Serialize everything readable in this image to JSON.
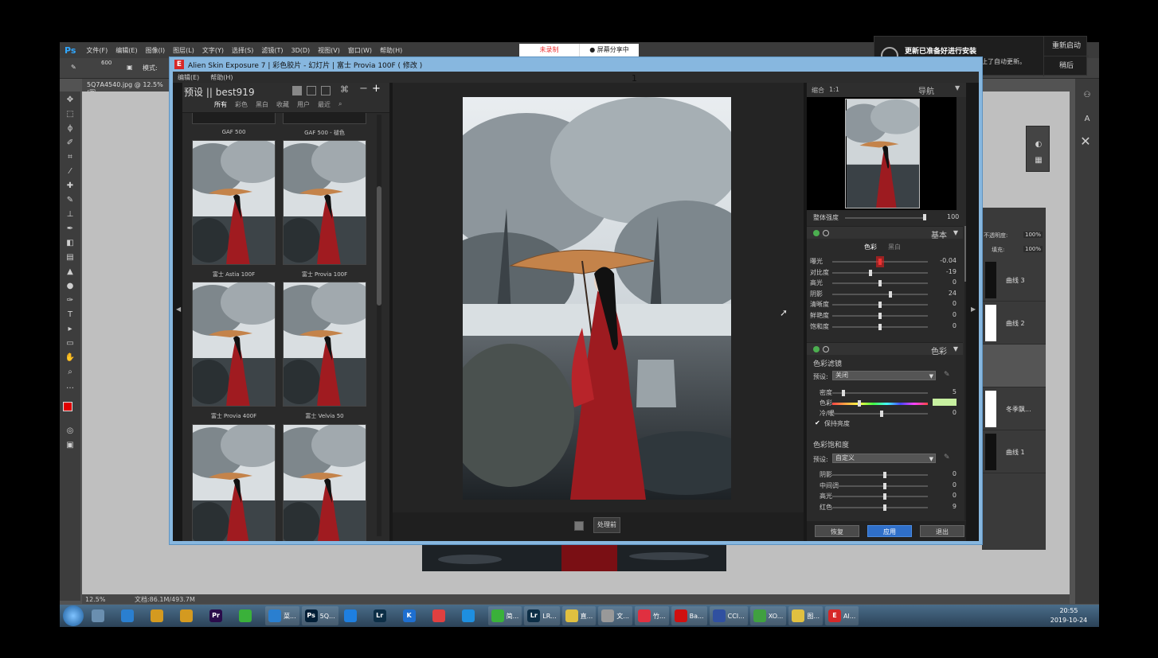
{
  "photoshop": {
    "logo": "Ps",
    "menu": [
      "文件(F)",
      "编辑(E)",
      "图像(I)",
      "图层(L)",
      "文字(Y)",
      "选择(S)",
      "滤镜(T)",
      "3D(D)",
      "视图(V)",
      "窗口(W)",
      "帮助(H)"
    ],
    "options": {
      "brush_size": "600",
      "mode_label": "模式:"
    },
    "doc_tab": "5Q7A4540.jpg @ 12.5% (图",
    "status_zoom": "12.5%",
    "status_doc": "文档:86.1M/493.7M",
    "layers": {
      "opacity_label": "不透明度:",
      "opacity_value": "100%",
      "fill_label": "填充:",
      "fill_value": "100%",
      "items": [
        "曲线 3",
        "曲线 2",
        "",
        "冬季飘...",
        "曲线 1"
      ]
    }
  },
  "notification": {
    "title": "更新已准备好进行安装",
    "body": "某些当前正在使用的应用阻止了自动更新。",
    "btn_restart": "重新启动",
    "btn_later": "稍后"
  },
  "recording": {
    "status": "未录制",
    "share": "● 屏幕分享中"
  },
  "exposure": {
    "logo": "E",
    "title": "Alien Skin Exposure 7 | 彩色胶片 - 幻灯片 | 富士 Provia 100F ( 修改 )",
    "menu": [
      "编辑(E)",
      "帮助(H)"
    ],
    "page_num": "1",
    "presets": {
      "title": "预设 || best919",
      "filters": [
        "所有",
        "彩色",
        "黑白",
        "收藏",
        "用户",
        "最近"
      ],
      "top_labels": [
        "GAF 500",
        "GAF 500 - 褪色"
      ],
      "items": [
        "富士 Astia 100F",
        "富士 Provia 100F",
        "富士 Provia 400F",
        "富士 Velvia 50",
        "",
        ""
      ]
    },
    "before_btn": "处理前",
    "nav": {
      "zoom": "缩合",
      "ratio": "1:1",
      "title": "导航"
    },
    "overall": {
      "label": "整体强度",
      "value": "100"
    },
    "basic": {
      "title": "基本",
      "tab_color": "色彩",
      "tab_bw": "黑白",
      "sliders": [
        {
          "label": "曝光",
          "value": "-0.04"
        },
        {
          "label": "对比度",
          "value": "-19"
        },
        {
          "label": "高光",
          "value": "0"
        },
        {
          "label": "阴影",
          "value": "24"
        },
        {
          "label": "清晰度",
          "value": "0"
        },
        {
          "label": "鲜艳度",
          "value": "0"
        },
        {
          "label": "饱和度",
          "value": "0"
        }
      ]
    },
    "color": {
      "title": "色彩",
      "filter_title": "色彩滤镜",
      "preset_label": "预设:",
      "preset_value": "关闭",
      "sliders": [
        {
          "label": "密度",
          "value": "5"
        },
        {
          "label": "色彩",
          "value": ""
        },
        {
          "label": "冷/暖",
          "value": "0"
        }
      ],
      "swatch_color": "#c7f0a0",
      "keep_luma": "保持亮度",
      "sat_title": "色彩饱和度",
      "sat_preset_label": "预设:",
      "sat_preset_value": "自定义",
      "sat_sliders": [
        {
          "label": "阴影",
          "value": "0"
        },
        {
          "label": "中间调",
          "value": "0"
        },
        {
          "label": "高光",
          "value": "0"
        },
        {
          "label": "红色",
          "value": "9"
        }
      ]
    },
    "buttons": {
      "reset": "恢复",
      "apply": "应用",
      "exit": "退出"
    }
  },
  "taskbar": {
    "items": [
      {
        "icon": "",
        "label": "",
        "color": "#6a8fb0"
      },
      {
        "icon": "",
        "label": "",
        "color": "#2a7fd0"
      },
      {
        "icon": "",
        "label": "",
        "color": "#d49a20"
      },
      {
        "icon": "",
        "label": "",
        "color": "#d49a20"
      },
      {
        "icon": "Pr",
        "label": "",
        "color": "#2a0b4a"
      },
      {
        "icon": "",
        "label": "",
        "color": "#3ab13a"
      },
      {
        "icon": "",
        "label": "菜...",
        "color": "#2a7fd0"
      },
      {
        "icon": "Ps",
        "label": "5Q...",
        "color": "#001e36"
      },
      {
        "icon": "",
        "label": "",
        "color": "#1e7fe0"
      },
      {
        "icon": "Lr",
        "label": "",
        "color": "#0c2e46"
      },
      {
        "icon": "K",
        "label": "",
        "color": "#1e6fd0"
      },
      {
        "icon": "",
        "label": "",
        "color": "#e04040"
      },
      {
        "icon": "",
        "label": "",
        "color": "#1e8fe0"
      },
      {
        "icon": "",
        "label": "简...",
        "color": "#3ab13a"
      },
      {
        "icon": "Lr",
        "label": "LR...",
        "color": "#0c2e46"
      },
      {
        "icon": "",
        "label": "直...",
        "color": "#e0c040"
      },
      {
        "icon": "",
        "label": "文...",
        "color": "#999999"
      },
      {
        "icon": "",
        "label": "竹...",
        "color": "#e03040"
      },
      {
        "icon": "",
        "label": "Ba...",
        "color": "#d01010"
      },
      {
        "icon": "",
        "label": "CCI...",
        "color": "#3050a0"
      },
      {
        "icon": "",
        "label": "XO...",
        "color": "#40a040"
      },
      {
        "icon": "",
        "label": "图...",
        "color": "#e0c040"
      },
      {
        "icon": "E",
        "label": "Al...",
        "color": "#d62828"
      }
    ],
    "time": "20:55",
    "date": "2019-10-24"
  }
}
